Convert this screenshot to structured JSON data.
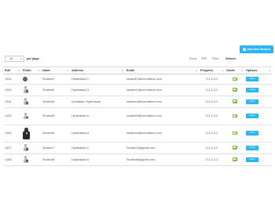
{
  "toolbar": {
    "add_button_label": "Add New Student",
    "add_icon": "+"
  },
  "controls": {
    "page_length": "10",
    "per_page_label": "per page",
    "exports": [
      "Excel",
      "PDF",
      "Print"
    ],
    "search_label": "Search:"
  },
  "table": {
    "headers": [
      "Roll",
      "Photo",
      "Name",
      "Address",
      "Email",
      "Progress",
      "Grade",
      "Options"
    ],
    "rows": [
      {
        "roll": "1201",
        "photo": "circle-photo",
        "name": "Student1",
        "address": "Hyderabad-1",
        "email": "student1@schooltime.com",
        "progress": "2,4,1,3,2",
        "grade_icon": "grade-badge-icon",
        "option": "Option"
      },
      {
        "roll": "1202",
        "photo": "person-photo",
        "name": "Student2",
        "address": "Hyderabad-3",
        "email": "student2@schooltime.com",
        "progress": "2,4,1,3,2",
        "grade_icon": "grade-badge-icon",
        "option": "Option"
      },
      {
        "roll": "1204",
        "photo": "person-photo",
        "name": "Student4",
        "address": "Kondapur, Hyderabad",
        "email": "student4@schooltime.com",
        "progress": "2,4,1,3,2",
        "grade_icon": "grade-badge-icon",
        "option": "Option"
      },
      {
        "roll": "1205",
        "photo": "person-photo",
        "name": "Student5",
        "address": "Hyderabad-9",
        "email": "student5@schooltime.com",
        "progress": "2,4,1,3,2",
        "grade_icon": "grade-badge-icon",
        "option": "Option"
      },
      {
        "roll": "1206",
        "photo": "dark-photo",
        "name": "Student6",
        "address": "Hyderabad-4",
        "email": "student6@schooltime.com",
        "progress": "2,4,1,3,2",
        "grade_icon": "grade-badge-icon",
        "option": "Option"
      },
      {
        "roll": "1207",
        "photo": "person-photo",
        "name": "Student7",
        "address": "Hyderabad-1",
        "email": "Student7@gmail.com",
        "progress": "2,4,1,3,2",
        "grade_icon": "grade-badge-icon",
        "option": "Option"
      },
      {
        "roll": "1208",
        "photo": "person-photo",
        "name": "Student8",
        "address": "Hyderabad-9",
        "email": "Student8@gmail.com",
        "progress": "2,4,1,3,2",
        "grade_icon": "grade-badge-icon",
        "option": "Option"
      }
    ]
  },
  "colors": {
    "accent": "#29b6f6",
    "grade_green": "#7dc243"
  }
}
